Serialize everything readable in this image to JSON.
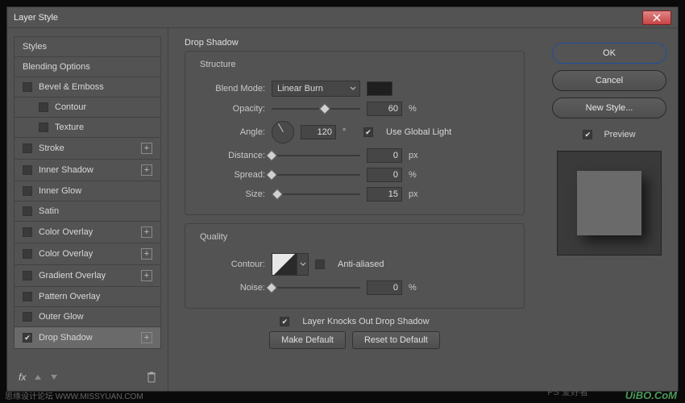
{
  "dialog": {
    "title": "Layer Style"
  },
  "styles_panel": {
    "header": "Styles",
    "blending": "Blending Options",
    "items": [
      {
        "label": "Bevel & Emboss",
        "checked": false,
        "plus": false
      },
      {
        "label": "Contour",
        "checked": false,
        "plus": false,
        "nested": true
      },
      {
        "label": "Texture",
        "checked": false,
        "plus": false,
        "nested": true
      },
      {
        "label": "Stroke",
        "checked": false,
        "plus": true
      },
      {
        "label": "Inner Shadow",
        "checked": false,
        "plus": true
      },
      {
        "label": "Inner Glow",
        "checked": false,
        "plus": false
      },
      {
        "label": "Satin",
        "checked": false,
        "plus": false
      },
      {
        "label": "Color Overlay",
        "checked": false,
        "plus": true
      },
      {
        "label": "Color Overlay",
        "checked": false,
        "plus": true
      },
      {
        "label": "Gradient Overlay",
        "checked": false,
        "plus": true
      },
      {
        "label": "Pattern Overlay",
        "checked": false,
        "plus": false
      },
      {
        "label": "Outer Glow",
        "checked": false,
        "plus": false
      },
      {
        "label": "Drop Shadow",
        "checked": true,
        "plus": true,
        "selected": true
      }
    ],
    "footer_fx": "fx"
  },
  "drop_shadow": {
    "title": "Drop Shadow",
    "structure": {
      "legend": "Structure",
      "blend_mode": {
        "label": "Blend Mode:",
        "value": "Linear Burn"
      },
      "opacity": {
        "label": "Opacity:",
        "value": "60",
        "unit": "%",
        "pct": 60
      },
      "angle": {
        "label": "Angle:",
        "value": "120",
        "unit": "°"
      },
      "global_light": {
        "label": "Use Global Light",
        "checked": true
      },
      "distance": {
        "label": "Distance:",
        "value": "0",
        "unit": "px",
        "pct": 0
      },
      "spread": {
        "label": "Spread:",
        "value": "0",
        "unit": "%",
        "pct": 0
      },
      "size": {
        "label": "Size:",
        "value": "15",
        "unit": "px",
        "pct": 6
      }
    },
    "quality": {
      "legend": "Quality",
      "contour_label": "Contour:",
      "anti_aliased": {
        "label": "Anti-aliased",
        "checked": false
      },
      "noise": {
        "label": "Noise:",
        "value": "0",
        "unit": "%",
        "pct": 0
      }
    },
    "knockout": {
      "label": "Layer Knocks Out Drop Shadow",
      "checked": true
    },
    "make_default": "Make Default",
    "reset_default": "Reset to Default"
  },
  "right": {
    "ok": "OK",
    "cancel": "Cancel",
    "new_style": "New Style...",
    "preview": {
      "label": "Preview",
      "checked": true
    }
  },
  "watermarks": {
    "left": "思缘设计论坛  WWW.MISSYUAN.COM",
    "right": "UiBO.CoM",
    "chinese": "PS 爱好者"
  }
}
